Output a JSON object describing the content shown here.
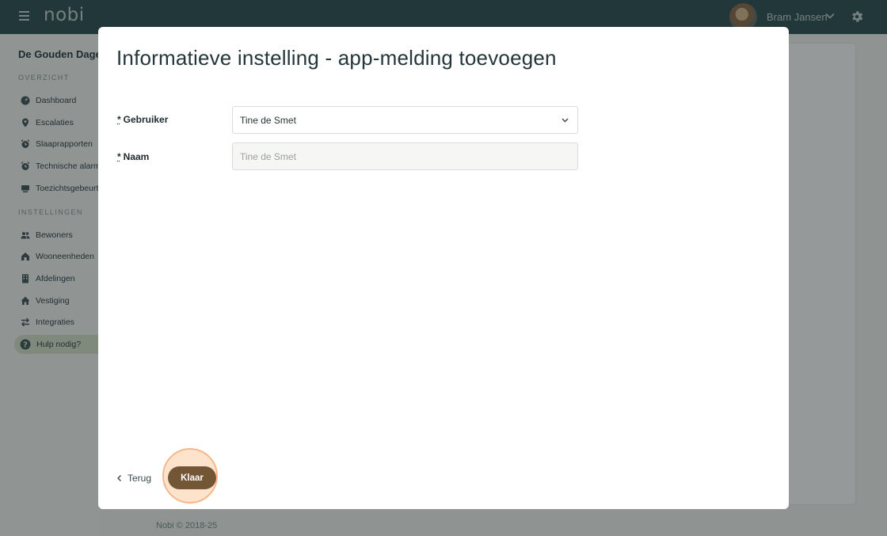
{
  "header": {
    "logo": "nobi",
    "user_name": "Bram Jansen"
  },
  "sidebar": {
    "org_name": "De Gouden Dagen",
    "section_overview": "OVERZICHT",
    "overview_items": [
      {
        "label": "Dashboard",
        "icon": "dashboard-icon"
      },
      {
        "label": "Escalaties",
        "icon": "pin-icon"
      },
      {
        "label": "Slaaprapporten",
        "icon": "alarm-clock-icon"
      },
      {
        "label": "Technische alarmen",
        "icon": "alarm-clock-icon"
      },
      {
        "label": "Toezichtsgebeurtenissen",
        "icon": "monitor-icon"
      }
    ],
    "section_settings": "INSTELLINGEN",
    "settings_items": [
      {
        "label": "Bewoners",
        "icon": "people-icon"
      },
      {
        "label": "Wooneenheden",
        "icon": "house-icon"
      },
      {
        "label": "Afdelingen",
        "icon": "building-icon"
      },
      {
        "label": "Vestiging",
        "icon": "home-icon"
      },
      {
        "label": "Integraties",
        "icon": "swap-icon"
      },
      {
        "label": "Hulp nodig?",
        "icon": "help-icon"
      }
    ]
  },
  "footer": {
    "copyright": "Nobi © 2018-25"
  },
  "modal": {
    "title": "Informatieve instelling - app-melding toevoegen",
    "required_marker": "*",
    "user_label": "Gebruiker",
    "user_value": "Tine de Smet",
    "name_label": "Naam",
    "name_value": "Tine de Smet",
    "back_label": "Terug",
    "done_label": "Klaar"
  }
}
